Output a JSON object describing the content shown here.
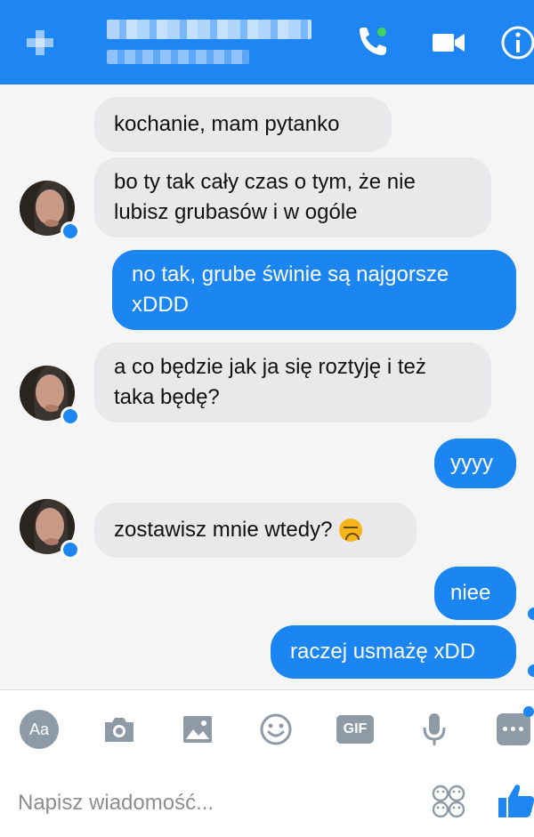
{
  "header": {
    "contact_name_blurred": "",
    "icons": [
      "back-icon",
      "phone-icon",
      "video-icon",
      "info-icon"
    ]
  },
  "messages": [
    {
      "sender": "them",
      "text": "kochanie, mam pytanko"
    },
    {
      "sender": "them",
      "text": "bo ty tak cały czas o tym, że nie lubisz grubasów i w ogóle"
    },
    {
      "sender": "me",
      "text": "no tak, grube świnie są najgorsze xDDD"
    },
    {
      "sender": "them",
      "text": "a co będzie jak ja się roztyję i też taka będę?"
    },
    {
      "sender": "me",
      "text": "yyyy"
    },
    {
      "sender": "them",
      "text": "zostawisz mnie wtedy?",
      "emoji": "disappointed-face-icon"
    },
    {
      "sender": "me",
      "text": "niee"
    },
    {
      "sender": "me",
      "text": "raczej usmażę xDD"
    }
  ],
  "toolbar": {
    "text_label": "Aa",
    "gif_label": "GIF",
    "icons": [
      "text-format-icon",
      "camera-icon",
      "image-icon",
      "emoji-icon",
      "gif-icon",
      "microphone-icon",
      "more-icon"
    ]
  },
  "input": {
    "placeholder": "Napisz wiadomość...",
    "value": ""
  },
  "colors": {
    "accent": "#1e86f2",
    "incoming_bubble": "#e9e9eb",
    "outgoing_bubble": "#1b86f2"
  }
}
